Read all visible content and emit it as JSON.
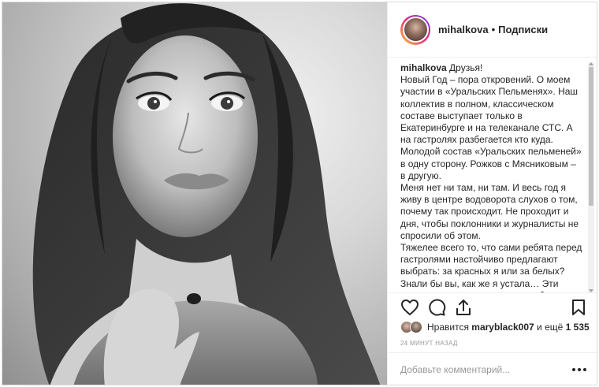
{
  "post": {
    "username": "mihalkova",
    "separator": "•",
    "follow_label": "Подписки",
    "caption_author": "mihalkova",
    "caption_paragraphs": [
      "Друзья!",
      "Новый Год – пора откровений. О моем участии в «Уральских Пельменях». Наш коллектив в полном, классическом составе выступает только в Екатеринбурге и на телеканале СТС. А на гастролях разбегается кто куда. Молодой состав «Уральских пельменей» в одну сторону. Рожков с Мясниковым – в другую.",
      "Меня нет ни там, ни там. И весь год я живу в центре водоворота слухов о том, почему так происходит. Не проходит и дня, чтобы поклонники и журналисты не спросили об этом.",
      "Тяжелее всего то, что сами ребята перед гастролями настойчиво предлагают выбрать: за красных я или за белых? Знали бы вы, как же я устала… Эти вопросы я воспринимаю очень близко,"
    ],
    "likes_prefix": "Нравится",
    "likes_user": "maryblack007",
    "likes_middle": "и ещё",
    "likes_count": "1 535",
    "time_ago": "24 минут назад",
    "comment_placeholder": "Добавьте комментарий..."
  },
  "icons": {
    "like": "heart-icon",
    "comment": "comment-icon",
    "share": "share-icon",
    "save": "bookmark-icon",
    "more": "more-dots-icon"
  },
  "colors": {
    "text": "#262626",
    "muted": "#999999",
    "border": "#efefef",
    "story_ring": [
      "#f9ce34",
      "#ee2a7b",
      "#6228d7"
    ]
  }
}
